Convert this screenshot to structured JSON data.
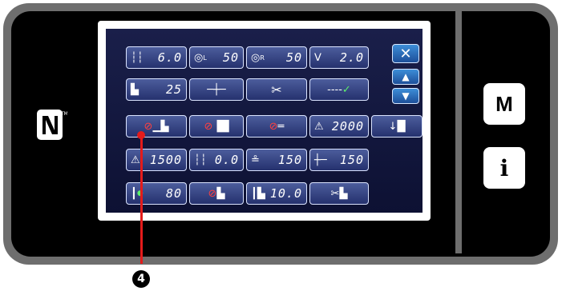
{
  "colors": {
    "button_gradient_top": "#4c5d9c",
    "button_gradient_bottom": "#25316e",
    "control_blue": "#2f78c8",
    "callout_red": "#e41b1b"
  },
  "side_buttons": {
    "mode_label": "M",
    "info_label": "i"
  },
  "grid": {
    "row1": [
      {
        "icon": "stitch-length-icon",
        "value": "6.0"
      },
      {
        "icon": "left-tension-icon",
        "subscript": "L",
        "value": "50"
      },
      {
        "icon": "right-tension-icon",
        "subscript": "R",
        "value": "50"
      },
      {
        "icon": "thread-tension-icon",
        "value": "2.0"
      }
    ],
    "row2": [
      {
        "icon": "presser-foot-pressure-icon",
        "value": "25"
      },
      {
        "icon": "needle-stop-position-icon",
        "value": ""
      },
      {
        "icon": "thread-trimmer-icon",
        "value": ""
      },
      {
        "icon": "stitch-pattern-icon",
        "value": ""
      }
    ],
    "row3": [
      {
        "icon": "presser-foot-lift-disabled-icon",
        "value": ""
      },
      {
        "icon": "reverse-feed-disabled-icon",
        "value": ""
      },
      {
        "icon": "wiper-disabled-icon",
        "value": ""
      },
      {
        "icon": "max-speed-icon",
        "value": "2000"
      },
      {
        "icon": "needle-up-down-icon",
        "value": ""
      }
    ],
    "row4": [
      {
        "icon": "start-speed-icon",
        "value": "1500"
      },
      {
        "icon": "feed-amount-icon",
        "value": "0.0"
      },
      {
        "icon": "soft-start-icon",
        "value": "150"
      },
      {
        "icon": "needle-speed-icon",
        "value": "150"
      }
    ],
    "row5": [
      {
        "icon": "bobbin-counter-icon",
        "value": "80"
      },
      {
        "icon": "presser-lift-disabled-icon",
        "value": ""
      },
      {
        "icon": "presser-foot-height-icon",
        "value": "10.0"
      },
      {
        "icon": "trim-and-lift-icon",
        "value": ""
      }
    ]
  },
  "callout": {
    "number": "4"
  }
}
